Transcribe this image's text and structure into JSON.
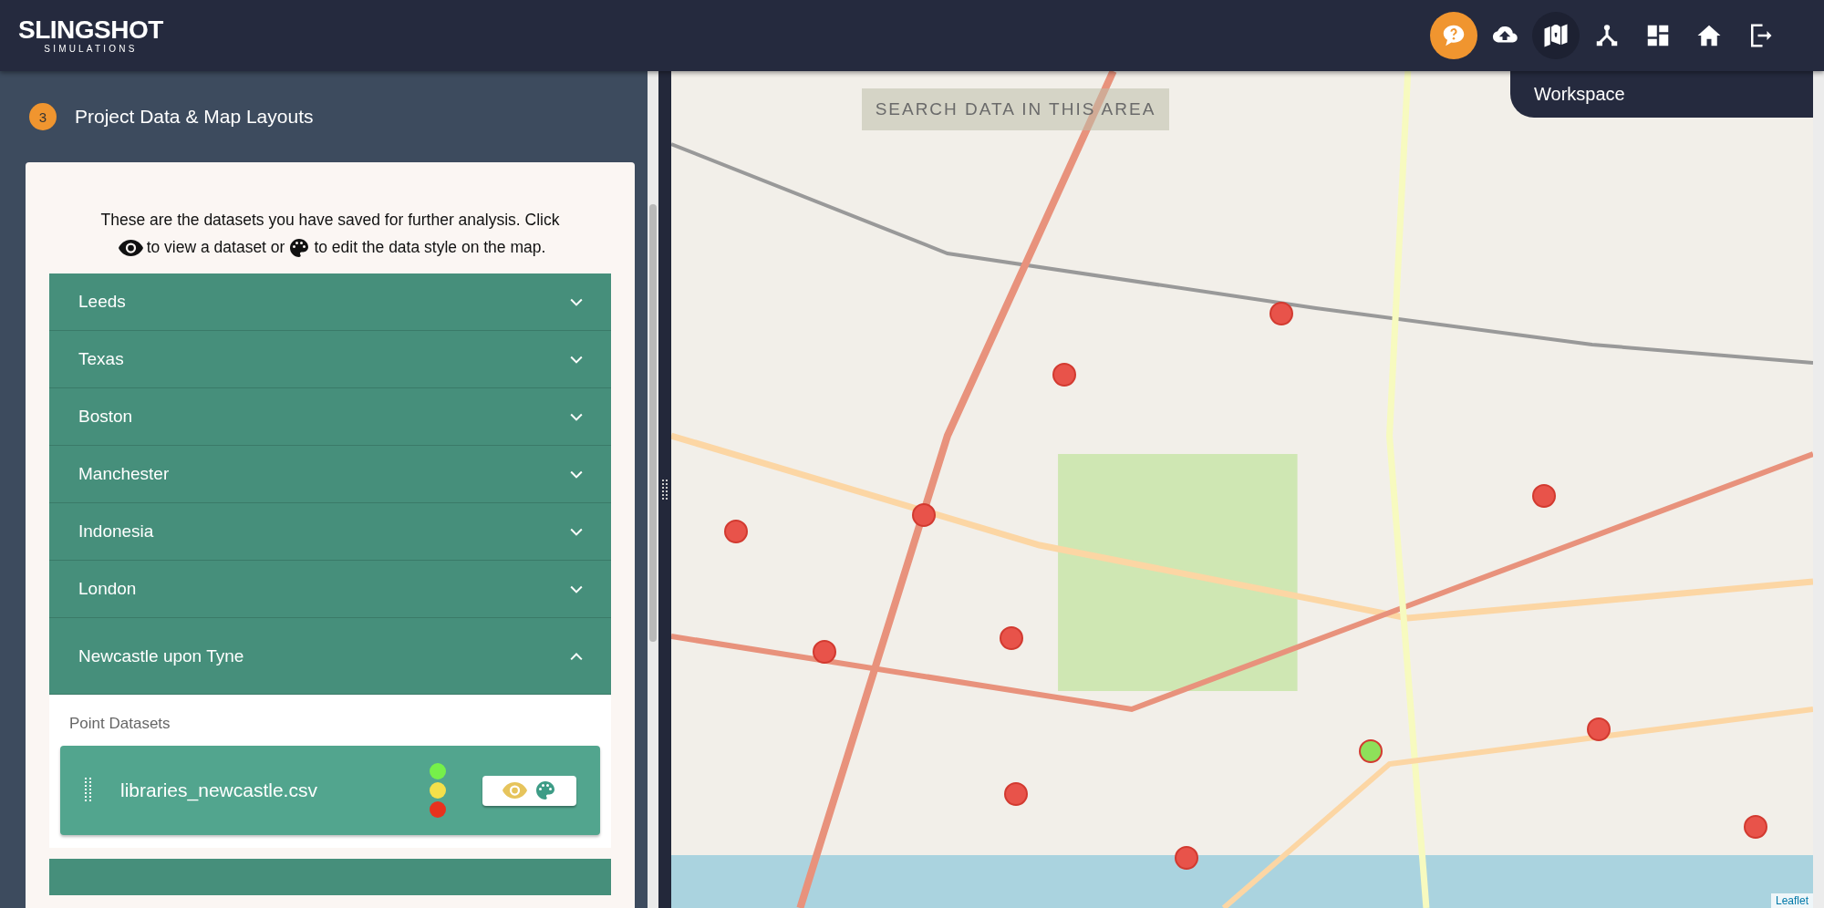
{
  "logo": {
    "name": "SLINGSHOT",
    "subtitle": "SIMULATIONS"
  },
  "nav": [
    {
      "kind": "help",
      "selected": false
    },
    {
      "kind": "upload",
      "selected": false
    },
    {
      "kind": "map",
      "selected": true
    },
    {
      "kind": "network",
      "selected": false
    },
    {
      "kind": "dashboard",
      "selected": false
    },
    {
      "kind": "home",
      "selected": false
    },
    {
      "kind": "logout",
      "selected": false
    }
  ],
  "tooltip": "Workspace",
  "step": {
    "number": "3",
    "title": "Project Data & Map Layouts"
  },
  "intro": {
    "text_1": "These are the datasets you have saved for further analysis. Click",
    "text_2": "to view a dataset or",
    "text_3": "to edit the data style on the map."
  },
  "projects": [
    {
      "label": "Leeds",
      "expanded": false
    },
    {
      "label": "Texas",
      "expanded": false
    },
    {
      "label": "Boston",
      "expanded": false
    },
    {
      "label": "Manchester",
      "expanded": false
    },
    {
      "label": "Indonesia",
      "expanded": false
    },
    {
      "label": "London",
      "expanded": false
    },
    {
      "label": "Newcastle upon Tyne",
      "expanded": true,
      "section": "Point Datasets",
      "datasets": [
        {
          "name": "libraries_newcastle.csv",
          "legend": [
            {
              "color": "#76f04a"
            },
            {
              "color": "#f4e04a"
            },
            {
              "color": "#e8321e"
            }
          ]
        }
      ]
    }
  ],
  "map": {
    "search_button": "SEARCH DATA IN THIS AREA",
    "attribution": "Leaflet",
    "markers": [
      {
        "color": "#e8534a"
      },
      {
        "color": "#e8534a"
      },
      {
        "color": "#e8534a"
      },
      {
        "color": "#e8534a"
      },
      {
        "color": "#e8534a"
      },
      {
        "color": "#e8534a"
      },
      {
        "color": "#e8534a"
      },
      {
        "color": "#e8534a"
      },
      {
        "color": "#e8534a"
      },
      {
        "color": "#e8534a"
      },
      {
        "color": "#e8534a"
      },
      {
        "color": "#8ee05a"
      }
    ]
  }
}
